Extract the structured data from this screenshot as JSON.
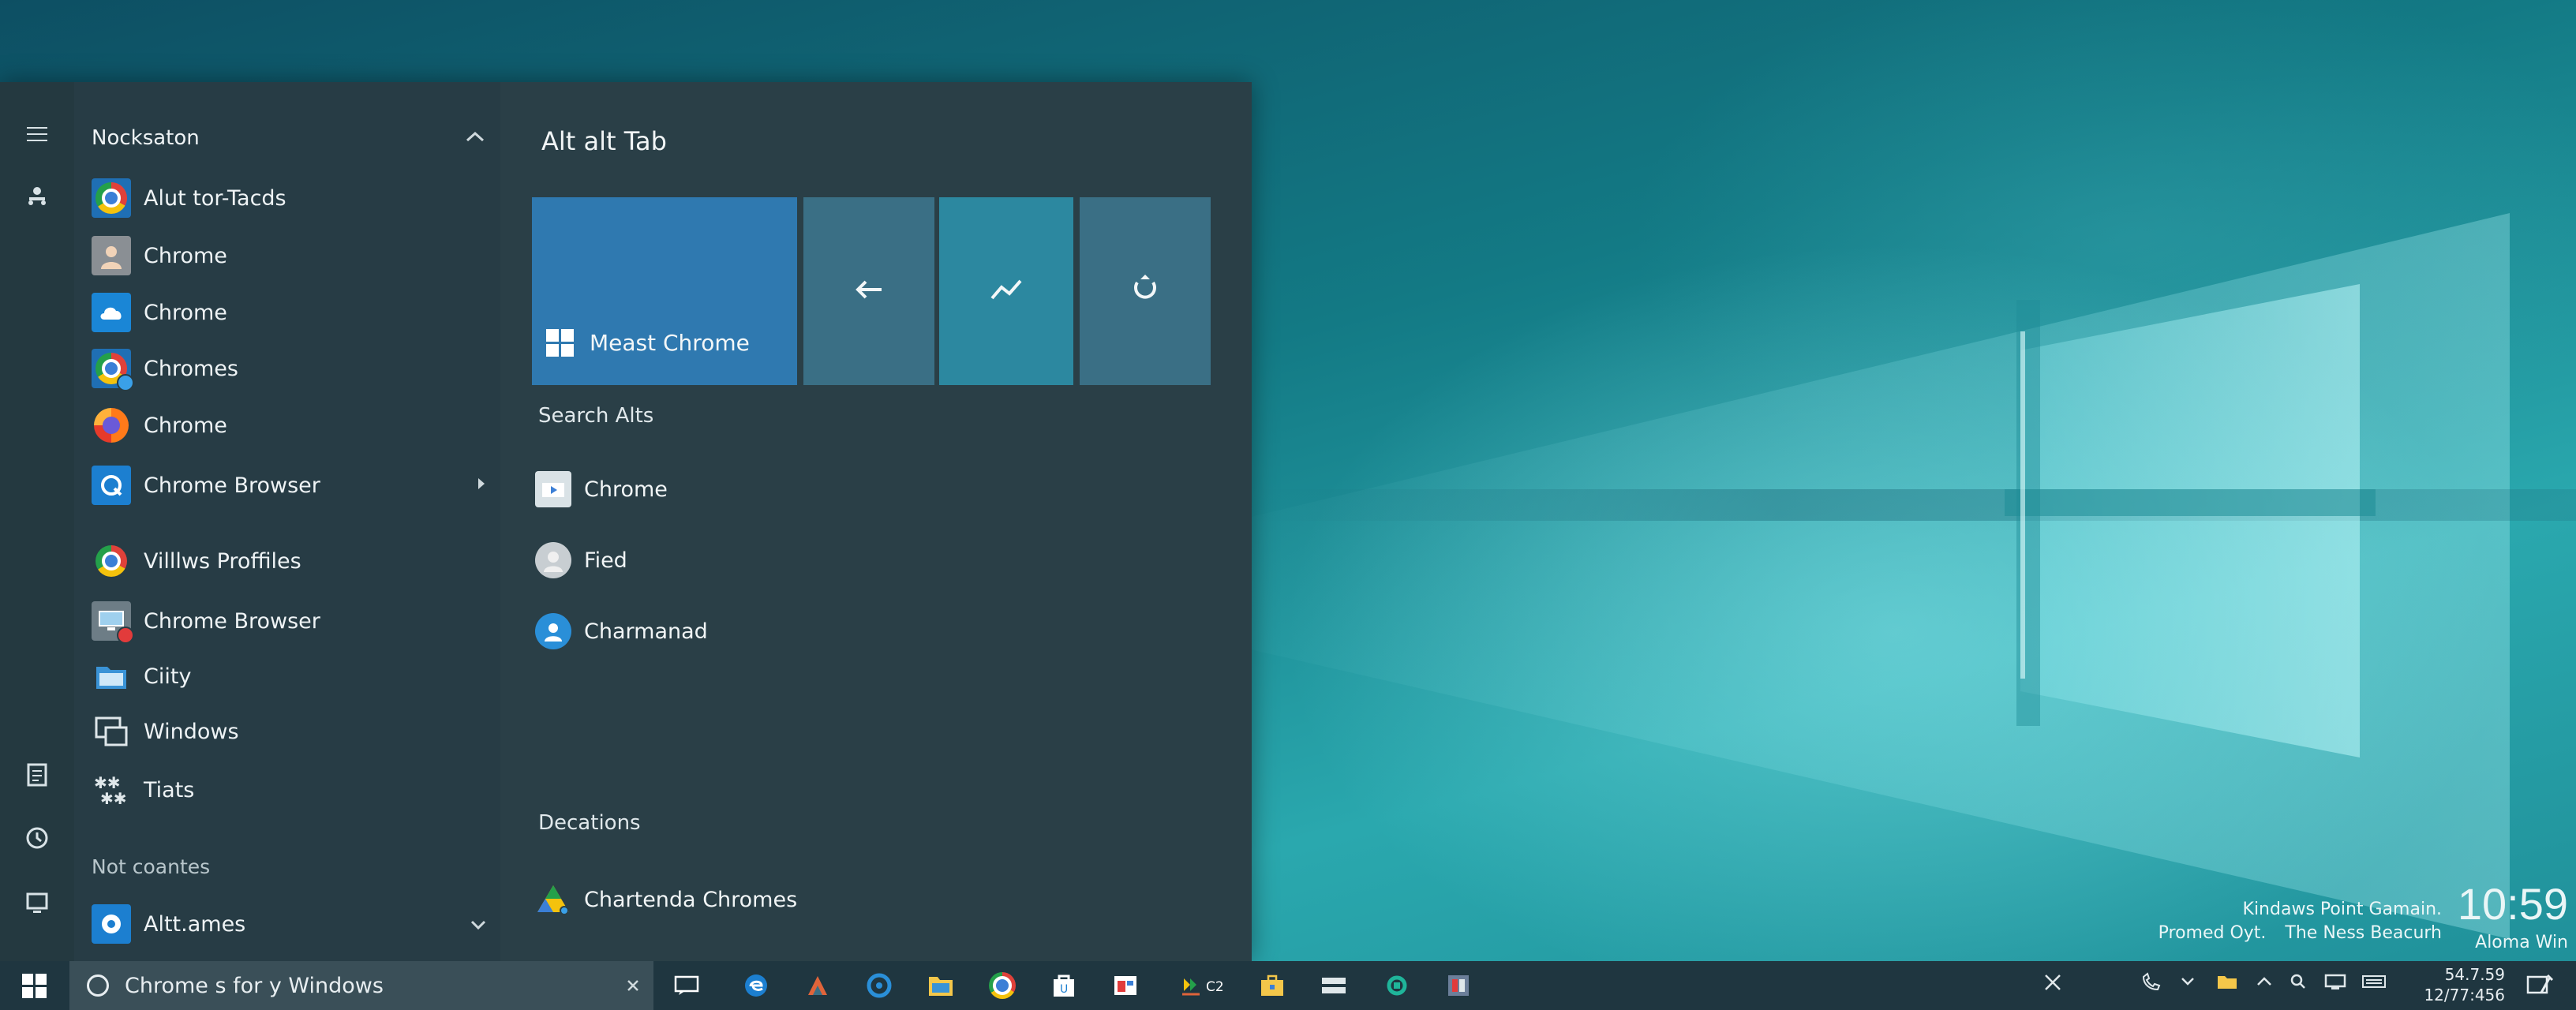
{
  "desktop": {
    "promo": {
      "line1": "Kindaws Point Gamain.",
      "line2a": "Promed Oyt.",
      "line2b": "The Ness Beacurh",
      "clock": "10:59",
      "line3": "Aloma Win"
    }
  },
  "start_menu": {
    "rail_icons": [
      "hamburger-icon",
      "user-network-icon",
      "document-icon",
      "clock-icon",
      "power-icon"
    ],
    "group_header": "Nocksaton",
    "apps": [
      {
        "label": "Alut tor-Tacds",
        "icon": "chrome-icon"
      },
      {
        "label": "Chrome",
        "icon": "person-icon"
      },
      {
        "label": "Chrome",
        "icon": "cloud-icon"
      },
      {
        "label": "Chromes",
        "icon": "chrome-icon"
      },
      {
        "label": "Chrome",
        "icon": "firefox-icon"
      },
      {
        "label": "Chrome Browser",
        "icon": "sync-icon"
      },
      {
        "label": "Villlws Proffiles",
        "icon": "chrome-icon"
      },
      {
        "label": "Chrome Browser",
        "icon": "monitor-icon"
      },
      {
        "label": "Ciity",
        "icon": "folder-icon"
      },
      {
        "label": "Windows",
        "icon": "window-icon"
      },
      {
        "label": "Tiats",
        "icon": "sparkle-icon"
      }
    ],
    "section_label": "Not coantes",
    "last_app": {
      "label": "Altt.ames",
      "icon": "edge-icon"
    },
    "tiles_title": "Alt alt Tab",
    "big_tile_label": "Meast Chrome",
    "search_section": "Search Alts",
    "search_results": [
      {
        "label": "Chrome",
        "icon": "video-folder-icon"
      },
      {
        "label": "Fied",
        "icon": "person-icon"
      },
      {
        "label": "Charmanad",
        "icon": "user-icon"
      }
    ],
    "decations_section": "Decations",
    "decation_item": {
      "label": "Chartenda Chromes",
      "icon": "drive-icon"
    }
  },
  "taskbar": {
    "search_text": "Chrome s for y Windows",
    "tray_time": "54.7.59",
    "tray_date": "12/77:456"
  },
  "colors": {
    "menu_bg": "#263c45",
    "tile_blue": "#2f79b0",
    "taskbar_bg": "#1f3640"
  }
}
